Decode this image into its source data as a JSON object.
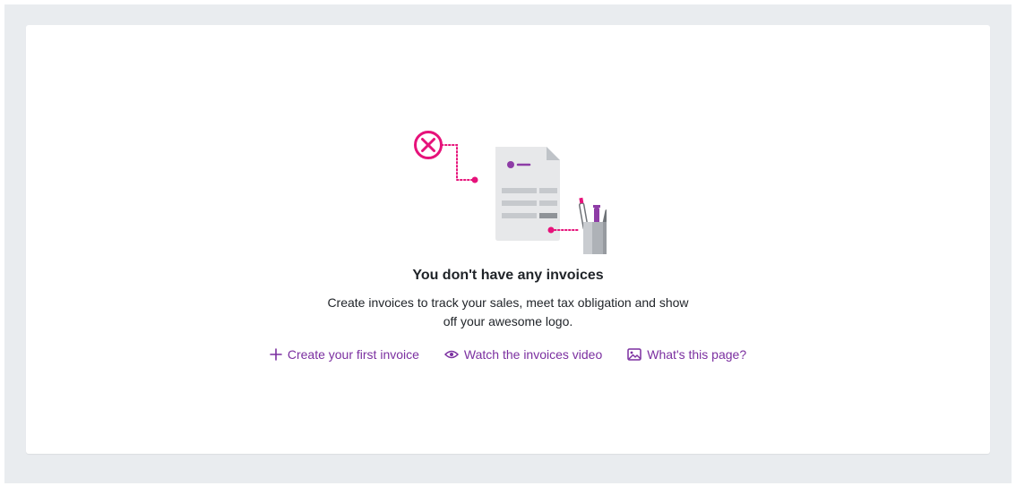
{
  "empty_state": {
    "title": "You don't have any invoices",
    "description": "Create invoices to track your sales, meet tax obligation and show off your awesome logo.",
    "illustration": "invoice-with-pen-cup-illustration",
    "status_icon": "close-circle-icon"
  },
  "actions": [
    {
      "label": "Create your first invoice",
      "icon": "plus-icon"
    },
    {
      "label": "Watch the invoices video",
      "icon": "eye-icon"
    },
    {
      "label": "What's this page?",
      "icon": "image-icon"
    }
  ],
  "colors": {
    "accent": "#7b2fa0",
    "magenta": "#e6127a",
    "background": "#e9ecef",
    "card": "#ffffff",
    "text": "#1f2328"
  }
}
